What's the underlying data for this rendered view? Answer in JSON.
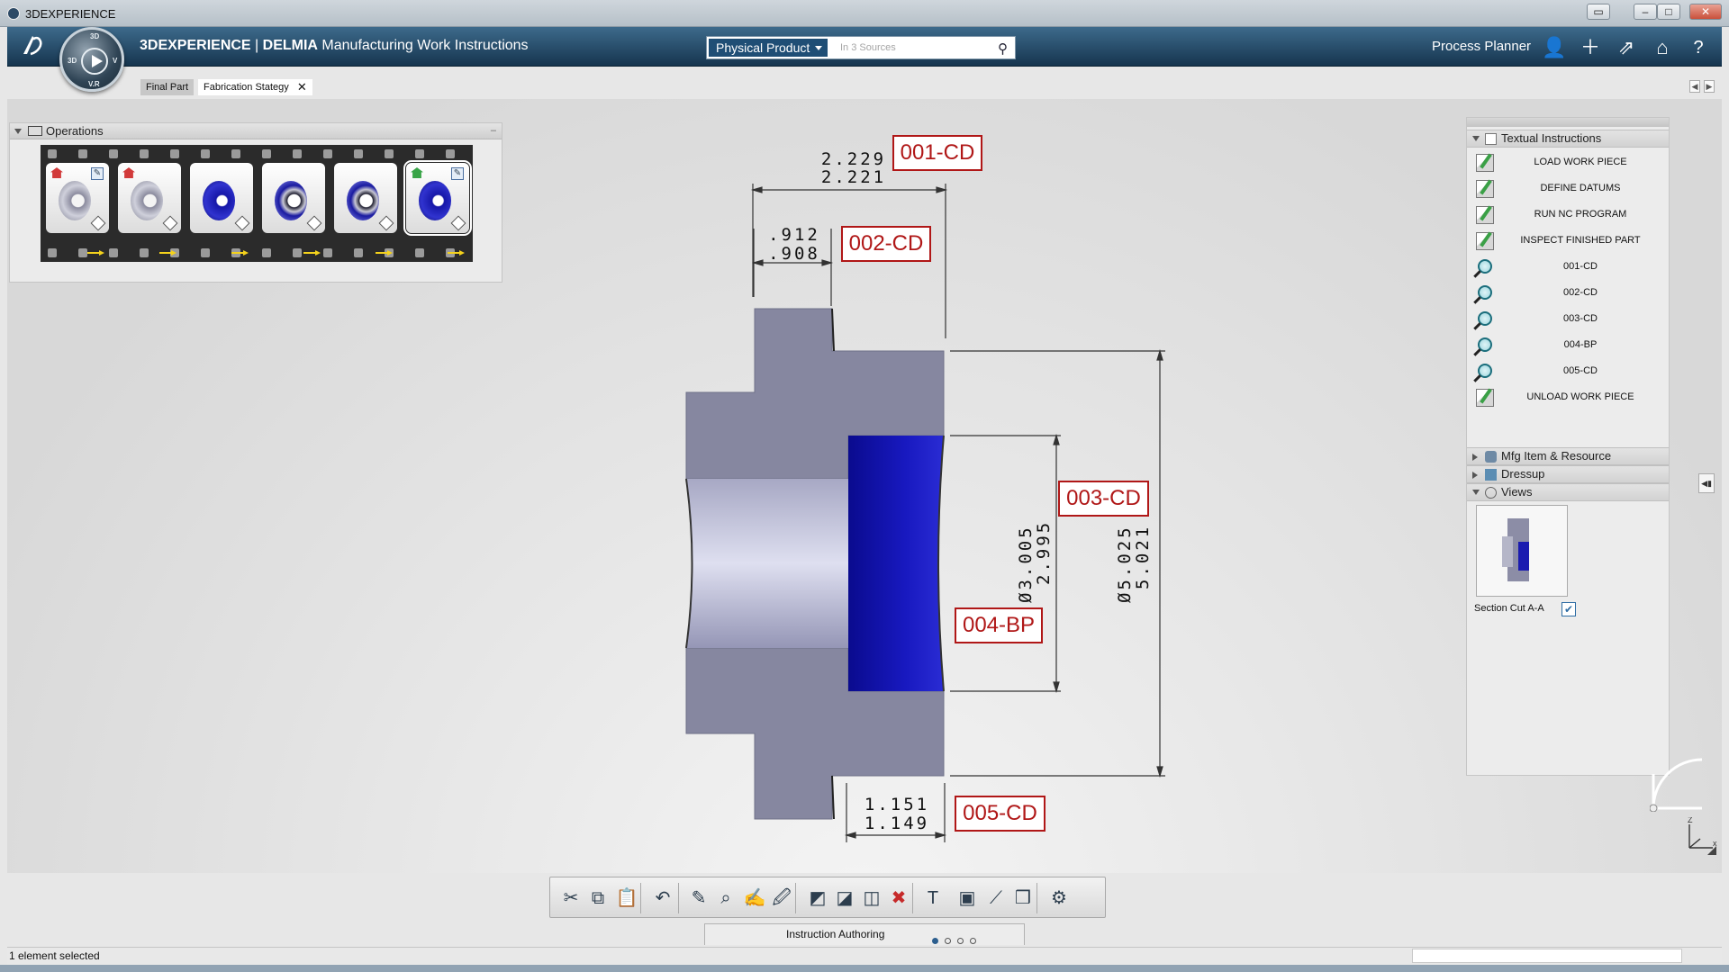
{
  "window": {
    "title": "3DEXPERIENCE"
  },
  "topbar": {
    "app_brand": "3DEXPERIENCE",
    "app_product": "DELMIA",
    "app_name": "Manufacturing Work Instructions",
    "compass_labels": {
      "top": "3D",
      "left": "3D",
      "right": "V",
      "bottom": "V.R"
    },
    "search_scope": "Physical Product",
    "search_placeholder": "In 3 Sources",
    "role": "Process Planner",
    "icons": [
      "user-icon",
      "plus-icon",
      "share-icon",
      "home-icon",
      "help-icon"
    ]
  },
  "tabs": [
    {
      "label": "Final Part"
    },
    {
      "label": "Fabrication Stategy"
    }
  ],
  "operations": {
    "title": "Operations",
    "frames": [
      {
        "part": "grey",
        "status": "red",
        "editable": true
      },
      {
        "part": "grey",
        "status": "red",
        "editable": false
      },
      {
        "part": "blue",
        "status": "",
        "editable": false
      },
      {
        "part": "ring",
        "status": "",
        "editable": false
      },
      {
        "part": "ring",
        "status": "",
        "editable": false
      },
      {
        "part": "blue",
        "status": "green",
        "editable": true,
        "selected": true
      }
    ]
  },
  "drawing": {
    "callouts": [
      "001-CD",
      "002-CD",
      "003-CD",
      "004-BP",
      "005-CD"
    ],
    "dims": {
      "d001": [
        "2.229",
        "2.221"
      ],
      "d002": [
        ".912",
        ".908"
      ],
      "d003": [
        "Ø3.005",
        "2.995"
      ],
      "d004": [
        "Ø5.025",
        "5.021"
      ],
      "d005": [
        "1.151",
        "1.149"
      ]
    },
    "colors": {
      "part_grey": "#8687a0",
      "part_blue": "#1011b0",
      "callout_red": "#b01717"
    }
  },
  "right_panel": {
    "textual_instructions_title": "Textual Instructions",
    "instructions": [
      {
        "label": "LOAD WORK PIECE",
        "icon": "edit-note-icon"
      },
      {
        "label": "DEFINE DATUMS",
        "icon": "edit-note-icon"
      },
      {
        "label": "RUN NC PROGRAM",
        "icon": "edit-note-icon"
      },
      {
        "label": "INSPECT FINISHED PART",
        "icon": "edit-note-icon"
      },
      {
        "label": "001-CD",
        "icon": "magnifier-icon"
      },
      {
        "label": "002-CD",
        "icon": "magnifier-icon"
      },
      {
        "label": "003-CD",
        "icon": "magnifier-icon"
      },
      {
        "label": "004-BP",
        "icon": "magnifier-icon"
      },
      {
        "label": "005-CD",
        "icon": "magnifier-icon"
      },
      {
        "label": "UNLOAD WORK PIECE",
        "icon": "edit-note-icon"
      }
    ],
    "sections": [
      {
        "label": "Mfg Item & Resource"
      },
      {
        "label": "Dressup"
      },
      {
        "label": "Views"
      }
    ],
    "view": {
      "label": "Section Cut A-A",
      "checked": true
    }
  },
  "toolbar": {
    "icons": [
      "cut-icon",
      "copy-icon",
      "paste-icon",
      "undo-icon",
      "text-instruction-icon",
      "inspect-instruction-icon",
      "edit-instruction-icon",
      "instruction-icon",
      "capture-icon",
      "capture-2-icon",
      "capture-3-icon",
      "delete-capture-icon",
      "text-style-icon",
      "display-icon",
      "measure-icon",
      "box-icon",
      "settings-icon"
    ]
  },
  "mode": {
    "label": "Instruction Authoring",
    "pages": 4,
    "active": 0
  },
  "status": {
    "text": "1 element selected"
  }
}
